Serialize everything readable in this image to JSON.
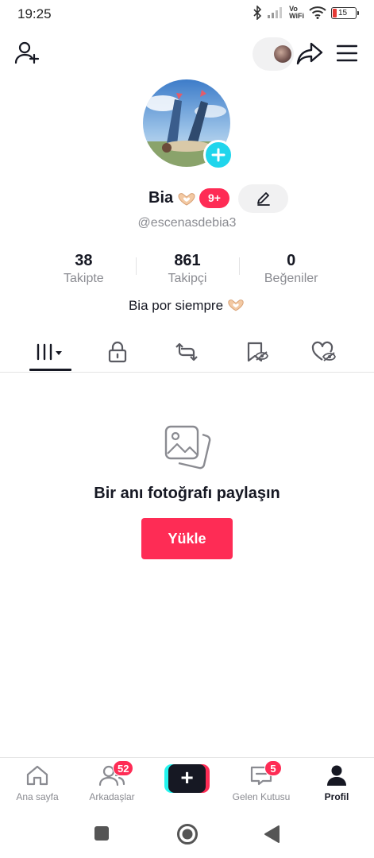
{
  "status_bar": {
    "time": "19:25",
    "network_label_top": "Vo",
    "network_label_bottom": "WiFi",
    "battery_level": "15",
    "icons": [
      "bluetooth-icon",
      "signal-icon",
      "wifi-icon",
      "battery-icon"
    ]
  },
  "header": {
    "add_friend_icon": "person-add-icon",
    "share_icon": "share-arrow-icon",
    "menu_icon": "hamburger-menu-icon"
  },
  "profile": {
    "display_name": "Bia",
    "notification_badge": "9+",
    "username": "@escenasdebia3",
    "bio": "Bia por siempre",
    "stats": [
      {
        "value": "38",
        "label": "Takipte"
      },
      {
        "value": "861",
        "label": "Takipçi"
      },
      {
        "value": "0",
        "label": "Beğeniler"
      }
    ]
  },
  "tabs": [
    {
      "icon": "grid-videos-icon",
      "active": true
    },
    {
      "icon": "lock-icon",
      "active": false
    },
    {
      "icon": "repost-icon",
      "active": false
    },
    {
      "icon": "favorites-hidden-icon",
      "active": false
    },
    {
      "icon": "liked-hidden-icon",
      "active": false
    }
  ],
  "empty_state": {
    "icon": "photo-stack-icon",
    "title": "Bir anı fotoğrafı paylaşın",
    "button_label": "Yükle"
  },
  "bottom_nav": {
    "items": [
      {
        "label": "Ana sayfa",
        "icon": "home-icon"
      },
      {
        "label": "Arkadaşlar",
        "icon": "friends-icon",
        "badge": "52"
      },
      {
        "label": "",
        "icon": "plus-icon"
      },
      {
        "label": "Gelen Kutusu",
        "icon": "inbox-icon",
        "badge": "5"
      },
      {
        "label": "Profil",
        "icon": "profile-icon",
        "active": true
      }
    ]
  },
  "colors": {
    "accent": "#fe2c55",
    "cyan": "#20d5ec",
    "text_primary": "#161823",
    "text_secondary": "#8a8b91"
  }
}
